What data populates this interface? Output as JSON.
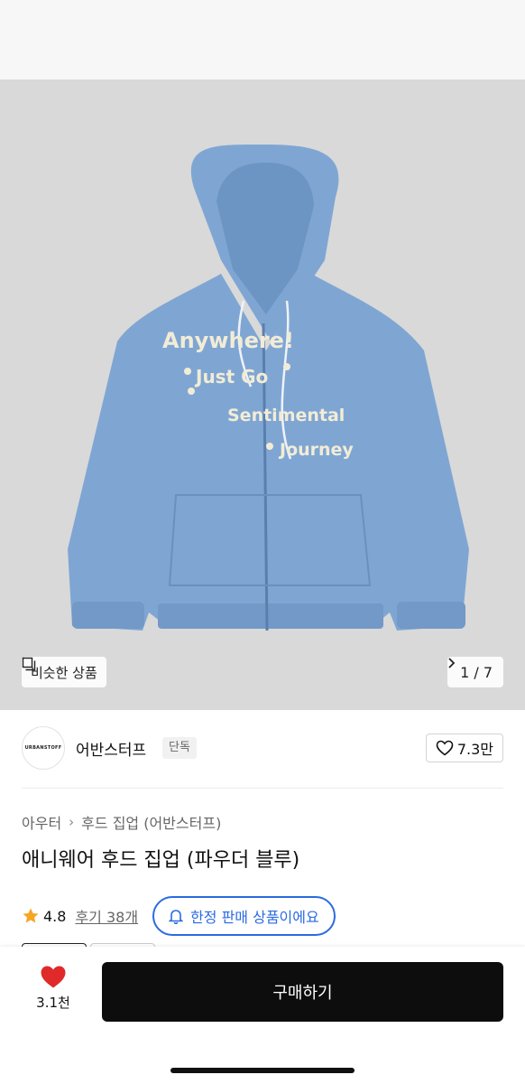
{
  "gallery": {
    "similar_label": "비슷한 상품",
    "counter": "1 / 7",
    "image_text": {
      "line1": "Anywhere!",
      "line2": "Just Go",
      "line3": "Sentimental",
      "line4": "Journey"
    }
  },
  "brand": {
    "logo_text": "URBANSTOFF",
    "name": "어반스터프",
    "tag": "단독",
    "likes": "7.3만"
  },
  "breadcrumb": {
    "category": "아우터",
    "subcategory": "후드 집업 (어반스터프)"
  },
  "product": {
    "title": "애니웨어 후드 집업 (파우더 블루)",
    "rating": "4.8",
    "reviews": "후기 38개",
    "limited_label": "한정 판매 상품이에요"
  },
  "bottom_bar": {
    "heart_count": "3.1천",
    "buy_label": "구매하기"
  },
  "colors": {
    "hoodie": "#7fa6d3",
    "accent_blue": "#2a6be0",
    "heart_red": "#e02a2a",
    "star": "#f5a623"
  }
}
